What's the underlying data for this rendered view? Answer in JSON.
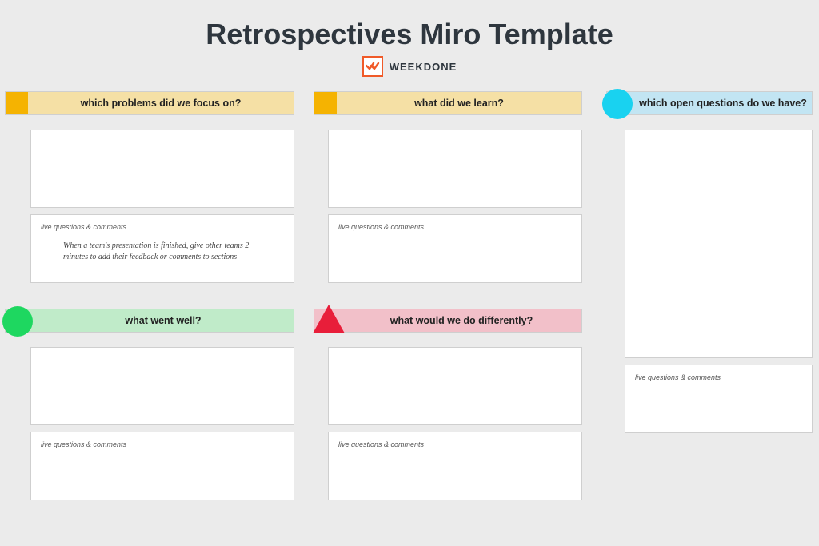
{
  "header": {
    "title": "Retrospectives Miro Template",
    "brand": "WEEKDONE"
  },
  "comments_label": "live questions & comments",
  "sections": {
    "problems": {
      "title": "which problems did we focus on?",
      "comment_text": "When a team's presentation is finished, give other teams 2 minutes to add their feedback or comments to sections"
    },
    "learn": {
      "title": "what did we learn?",
      "comment_text": ""
    },
    "open": {
      "title": "which open questions do we have?",
      "comment_text": ""
    },
    "wentwell": {
      "title": "what went well?",
      "comment_text": ""
    },
    "differently": {
      "title": "what would we do differently?",
      "comment_text": ""
    }
  }
}
